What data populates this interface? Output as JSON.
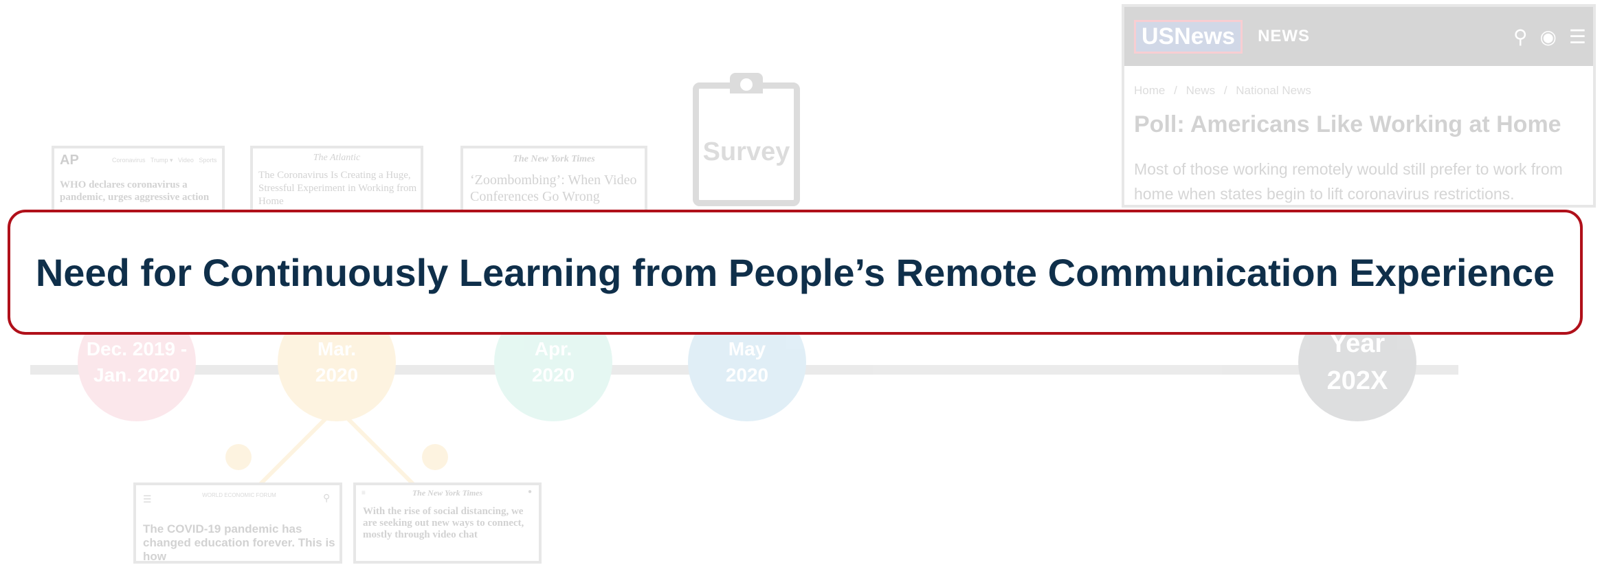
{
  "banner": {
    "text": "Need for Continuously Learning from People’s Remote Communication Experience"
  },
  "timeline": {
    "nodes": [
      {
        "line1": "Dec. 2019 -",
        "line2": "Jan. 2020",
        "color": "#f08aa0"
      },
      {
        "line1": "Mar.",
        "line2": "2020",
        "color": "#f6c86a"
      },
      {
        "line1": "Apr.",
        "line2": "2020",
        "color": "#7fdcc0"
      },
      {
        "line1": "May",
        "line2": "2020",
        "color": "#6aaed6"
      },
      {
        "line1": "Year",
        "line2": "202X",
        "color": "#5a5f63"
      }
    ]
  },
  "cards": {
    "ap": {
      "logo": "AP",
      "nav": "Coronavirus   Trump ▾   Video   Sports",
      "headline": "WHO declares coronavirus a pandemic, urges aggressive action"
    },
    "atlantic": {
      "masthead": "The Atlantic",
      "headline": "The Coronavirus Is Creating a Huge, Stressful Experiment in Working from Home"
    },
    "nyt_apr": {
      "masthead": "The New York Times",
      "headline": "‘Zoombombing’: When Video Conferences Go Wrong"
    },
    "survey": {
      "label": "Survey"
    },
    "usnews": {
      "logo": "USNews",
      "section": "NEWS",
      "breadcrumb_home": "Home",
      "breadcrumb_sep": "/",
      "breadcrumb_news": "News",
      "breadcrumb_national": "National News",
      "headline": "Poll: Americans Like Working at Home",
      "subhead": "Most of those working remotely would still prefer to work from home when states begin to lift coronavirus restrictions."
    },
    "wef": {
      "masthead": "WORLD ECONOMIC FORUM",
      "headline": "The COVID-19 pandemic has changed education forever. This is how"
    },
    "nyt_mar": {
      "masthead": "The New York Times",
      "headline": "With the rise of social distancing, we are seeking out new ways to connect, mostly through video chat"
    }
  }
}
